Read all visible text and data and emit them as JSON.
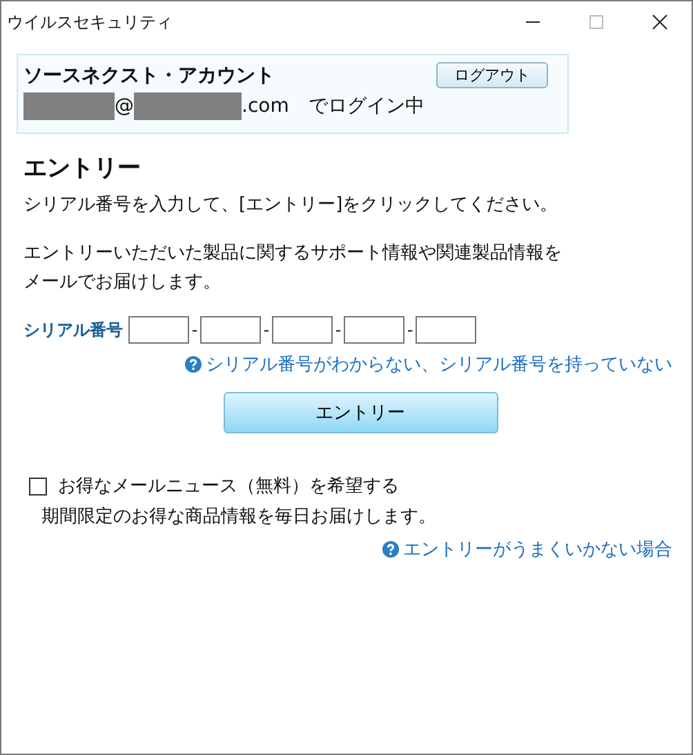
{
  "window": {
    "title": "ウイルスセキュリティ"
  },
  "account": {
    "title": "ソースネクスト・アカウント",
    "logout_button": "ログアウト",
    "login_line": [
      {
        "kind": "redacted"
      },
      {
        "kind": "text",
        "text": "@"
      },
      {
        "kind": "redacted"
      },
      {
        "kind": "text",
        "text": ".com"
      },
      {
        "kind": "status",
        "text": "でログイン中"
      }
    ]
  },
  "entry": {
    "heading": "エントリー",
    "instruction": "シリアル番号を入力して、[エントリー]をクリックしてください。",
    "note_lines": [
      "エントリーいただいた製品に関するサポート情報や関連製品情報を",
      "メールでお届けします。"
    ]
  },
  "serial": {
    "label": "シリアル番号",
    "parts": [
      {
        "kind": "field"
      },
      {
        "kind": "separator",
        "text": "-"
      },
      {
        "kind": "field"
      },
      {
        "kind": "separator",
        "text": "-"
      },
      {
        "kind": "field"
      },
      {
        "kind": "separator",
        "text": "-"
      },
      {
        "kind": "field"
      },
      {
        "kind": "separator",
        "text": "-"
      },
      {
        "kind": "field"
      }
    ],
    "help_link": "シリアル番号がわからない、シリアル番号を持っていない"
  },
  "entry_button": "エントリー",
  "newsletter": {
    "label": "お得なメールニュース（無料）を希望する",
    "checked": false,
    "description": "期間限定のお得な商品情報を毎日お届けします。"
  },
  "trouble_link": "エントリーがうまくいかない場合"
}
